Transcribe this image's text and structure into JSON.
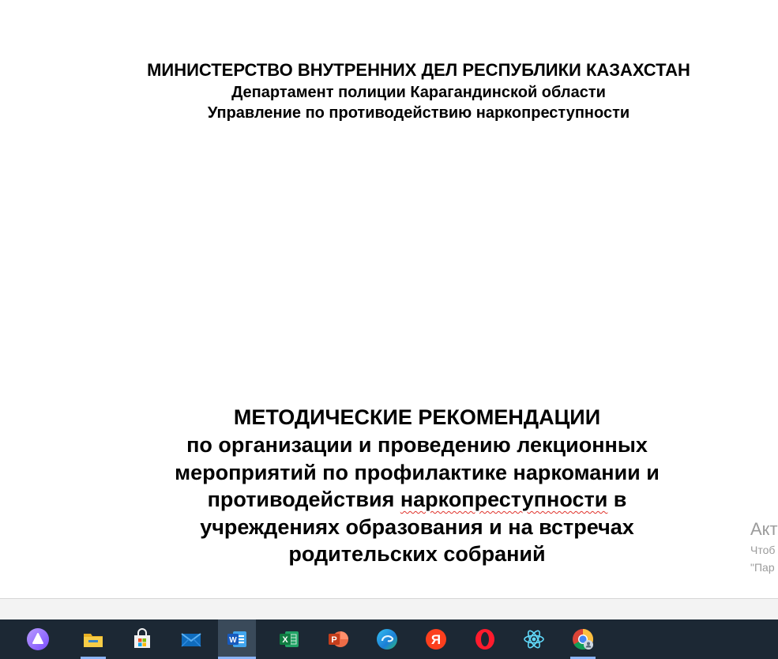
{
  "document": {
    "header": {
      "line1": "МИНИСТЕРСТВО ВНУТРЕННИХ ДЕЛ РЕСПУБЛИКИ КАЗАХСТАН",
      "line2": "Департамент полиции Карагандинской области",
      "line3": "Управление по противодействию наркопреступности"
    },
    "title": {
      "main": "МЕТОДИЧЕСКИЕ РЕКОМЕНДАЦИИ",
      "line1": "по организации и проведению лекционных",
      "line2": "мероприятий по профилактике наркомании и",
      "line3_before": "противодействия ",
      "line3_flagged": "наркопреступности",
      "line3_after": " в",
      "line4": "учреждениях образования и на встречах",
      "line5": "родительских собраний"
    }
  },
  "activation_watermark": {
    "title": "Акт",
    "line1": "Чтоб",
    "line2": "\"Пар"
  },
  "taskbar": {
    "items": [
      {
        "name": "alice-assistant",
        "icon": "alice-icon",
        "active": false,
        "running": false
      },
      {
        "name": "file-explorer",
        "icon": "folder-icon",
        "active": false,
        "running": true
      },
      {
        "name": "microsoft-store",
        "icon": "store-icon",
        "active": false,
        "running": false
      },
      {
        "name": "mail",
        "icon": "mail-icon",
        "active": false,
        "running": false
      },
      {
        "name": "word",
        "icon": "word-icon",
        "active": true,
        "running": true
      },
      {
        "name": "excel",
        "icon": "excel-icon",
        "active": false,
        "running": false
      },
      {
        "name": "powerpoint",
        "icon": "powerpoint-icon",
        "active": false,
        "running": false
      },
      {
        "name": "edge",
        "icon": "edge-icon",
        "active": false,
        "running": false
      },
      {
        "name": "yandex-browser",
        "icon": "yandex-icon",
        "active": false,
        "running": false
      },
      {
        "name": "opera",
        "icon": "opera-icon",
        "active": false,
        "running": false
      },
      {
        "name": "react-devtools",
        "icon": "react-icon",
        "active": false,
        "running": false
      },
      {
        "name": "chrome",
        "icon": "chrome-icon",
        "active": false,
        "running": true
      }
    ],
    "colors": {
      "background": "#1c2834",
      "active_background": "#3a4a5a",
      "running_indicator": "#8ab4f8"
    }
  },
  "colors": {
    "spellcheck_underline": "#e0322b",
    "watermark_text": "#9b9b9b"
  }
}
